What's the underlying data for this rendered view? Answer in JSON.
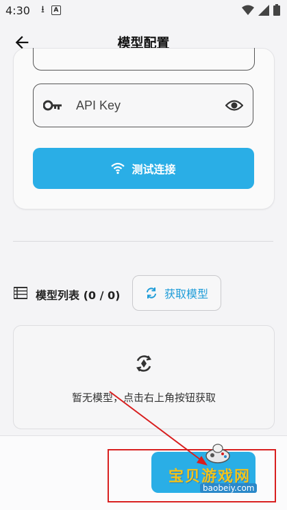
{
  "status_bar": {
    "time": "4:30"
  },
  "header": {
    "title": "模型配置"
  },
  "api_key": {
    "placeholder": "API Key"
  },
  "test_button": {
    "label": "测试连接"
  },
  "models": {
    "title": "模型列表 (0 / 0)",
    "fetch_label": "获取模型",
    "empty_text": "暂无模型，点击右上角按钮获取"
  },
  "watermark": {
    "text": "宝贝游戏网",
    "url": "baobeiy.com"
  },
  "colors": {
    "accent": "#2aaee6",
    "annotation": "#d81e1e",
    "background": "#f4f4f6"
  },
  "icons": [
    "arrow-back-icon",
    "key-icon",
    "eye-icon",
    "wifi-icon",
    "list-icon",
    "refresh-icon",
    "ai-sync-icon",
    "download-icon",
    "notification-a-icon",
    "wifi-status-icon",
    "signal-icon",
    "battery-icon"
  ]
}
